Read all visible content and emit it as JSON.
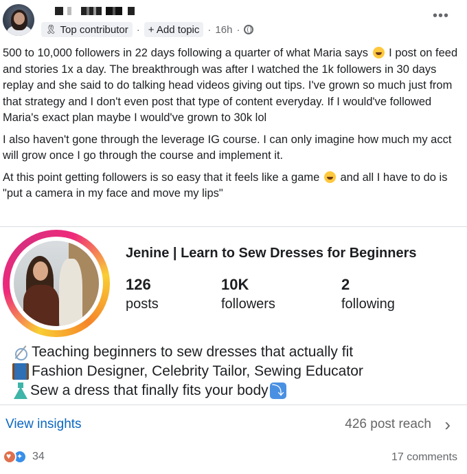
{
  "post": {
    "badge": "Top contributor",
    "add_topic": "+ Add topic",
    "time": "16h",
    "more": "•••",
    "paragraphs": {
      "p1a": "500 to 10,000 followers in 22 days following a quarter of what Maria says",
      "p1b": " I post on feed and stories 1x a day. The breakthrough was after I watched the 1k followers in 30 days replay and she said to do talking head videos giving out tips. I've grown so much just from that strategy and I don't even post that type of content everyday. If I would've followed Maria's exact plan maybe I would've grown to 30k lol",
      "p2": "I also haven't gone through the leverage IG course. I can only imagine how much my acct will grow once I go through the course and implement it.",
      "p3a": "At this point getting followers is so easy that it feels like a game",
      "p3b": " and all I have to do is \"put a camera in my face and move my lips\""
    }
  },
  "profile": {
    "name": "Jenine | Learn to Sew Dresses for Beginners",
    "stats": [
      {
        "num": "126",
        "label": "posts"
      },
      {
        "num": "10K",
        "label": "followers"
      },
      {
        "num": "2",
        "label": "following"
      }
    ],
    "bio": [
      "Teaching beginners to sew dresses that actually fit",
      "Fashion Designer, Celebrity Tailor, Sewing Educator",
      "Sew a dress that finally fits your body"
    ]
  },
  "footer": {
    "insights": "View insights",
    "reach": "426 post reach",
    "reaction_count": "34",
    "comments": "17 comments"
  },
  "icons": {
    "badge": "ribbon-icon",
    "visibility": "globe-icon",
    "emoji": "grinning-squinting-face-icon",
    "chevron": "chevron-right-icon"
  },
  "colors": {
    "link": "#0a66c2",
    "ring_start": "#f9ce34",
    "ring_mid": "#ee2a7b",
    "like": "#378fe9",
    "heart": "#df704d"
  }
}
